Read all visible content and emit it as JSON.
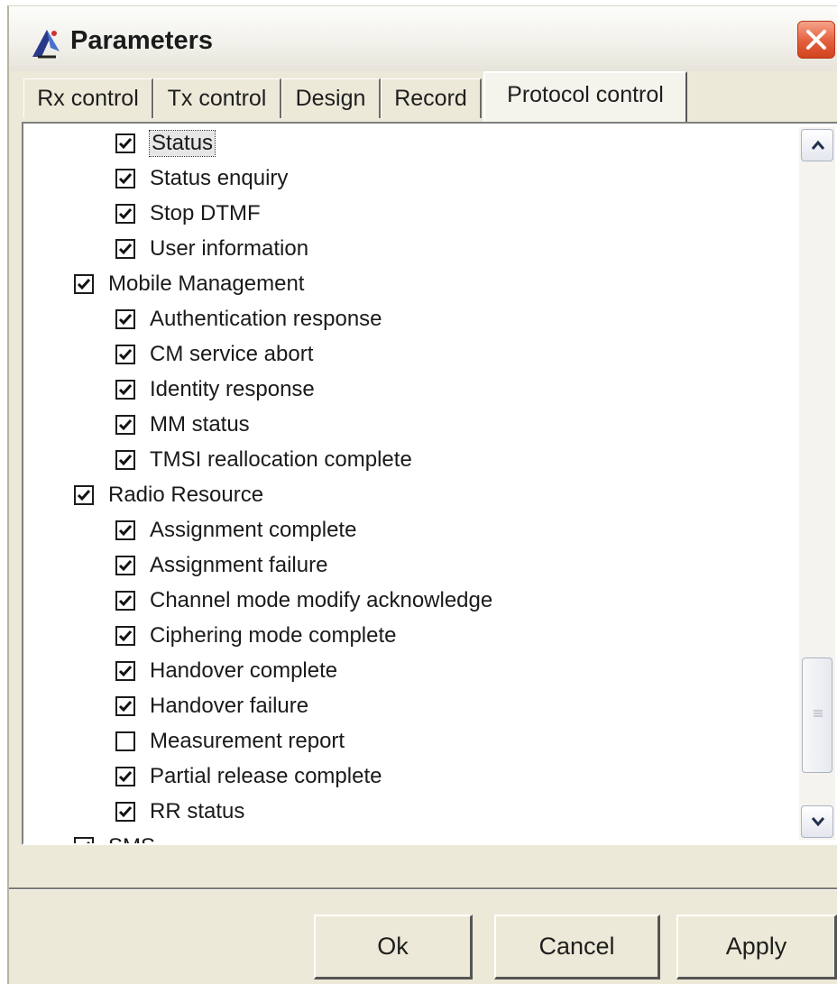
{
  "window": {
    "title": "Parameters",
    "close_icon": "close-icon",
    "app_icon": "radar-dish-icon"
  },
  "tabs": [
    {
      "label": "Rx control",
      "active": false
    },
    {
      "label": "Tx control",
      "active": false
    },
    {
      "label": "Design",
      "active": false
    },
    {
      "label": "Record",
      "active": false
    },
    {
      "label": "Protocol control",
      "active": true
    }
  ],
  "tree": [
    {
      "label": "Status",
      "checked": true,
      "level": 1,
      "focused": true
    },
    {
      "label": "Status enquiry",
      "checked": true,
      "level": 1
    },
    {
      "label": "Stop DTMF",
      "checked": true,
      "level": 1
    },
    {
      "label": "User information",
      "checked": true,
      "level": 1
    },
    {
      "label": "Mobile Management",
      "checked": true,
      "level": 0
    },
    {
      "label": "Authentication response",
      "checked": true,
      "level": 1
    },
    {
      "label": "CM service abort",
      "checked": true,
      "level": 1
    },
    {
      "label": "Identity response",
      "checked": true,
      "level": 1
    },
    {
      "label": "MM status",
      "checked": true,
      "level": 1
    },
    {
      "label": "TMSI reallocation complete",
      "checked": true,
      "level": 1
    },
    {
      "label": "Radio Resource",
      "checked": true,
      "level": 0
    },
    {
      "label": "Assignment complete",
      "checked": true,
      "level": 1
    },
    {
      "label": "Assignment failure",
      "checked": true,
      "level": 1
    },
    {
      "label": "Channel mode modify acknowledge",
      "checked": true,
      "level": 1
    },
    {
      "label": "Ciphering mode complete",
      "checked": true,
      "level": 1
    },
    {
      "label": "Handover complete",
      "checked": true,
      "level": 1
    },
    {
      "label": "Handover failure",
      "checked": true,
      "level": 1
    },
    {
      "label": "Measurement report",
      "checked": false,
      "level": 1
    },
    {
      "label": "Partial release complete",
      "checked": true,
      "level": 1
    },
    {
      "label": "RR status",
      "checked": true,
      "level": 1
    },
    {
      "label": "SMS",
      "checked": true,
      "level": 0
    }
  ],
  "buttons": {
    "ok": "Ok",
    "cancel": "Cancel",
    "apply": "Apply"
  },
  "colors": {
    "dialog_bg": "#ece9d8",
    "close_red": "#e45e3c",
    "list_bg": "#ffffff"
  }
}
